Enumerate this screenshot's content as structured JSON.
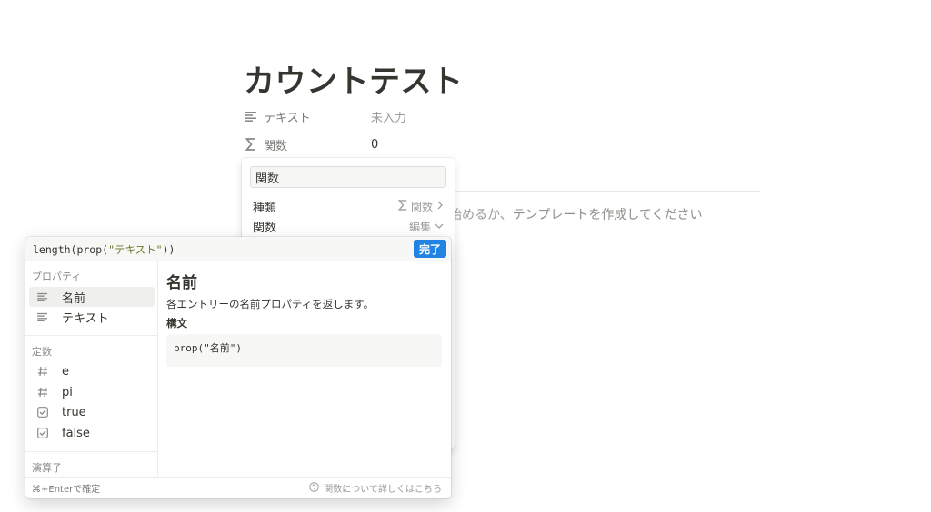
{
  "page": {
    "title": "カウントテスト",
    "properties": [
      {
        "icon": "text-lines-icon",
        "name": "テキスト",
        "value": "未入力"
      },
      {
        "icon": "sigma-icon",
        "name": "関数",
        "value": "0"
      }
    ],
    "empty_hint_prefix": "始めるか、",
    "empty_hint_link": "テンプレートを作成してください"
  },
  "property_popup": {
    "name_value": "関数",
    "type_label": "種類",
    "type_value": "関数",
    "formula_label": "関数",
    "formula_action": "編集"
  },
  "formula_editor": {
    "expression_prefix": "length(prop(",
    "expression_string": "\"テキスト\"",
    "expression_suffix": "))",
    "done_label": "完了",
    "sections": {
      "properties_label": "プロパティ",
      "properties": [
        {
          "icon": "text-lines-icon",
          "label": "名前",
          "selected": true
        },
        {
          "icon": "text-lines-icon",
          "label": "テキスト",
          "selected": false
        }
      ],
      "constants_label": "定数",
      "constants": [
        {
          "icon": "hash-icon",
          "label": "e"
        },
        {
          "icon": "hash-icon",
          "label": "pi"
        },
        {
          "icon": "checkbox-icon",
          "label": "true"
        },
        {
          "icon": "checkbox-icon",
          "label": "false"
        }
      ],
      "operators_label": "演算子"
    },
    "help": {
      "title": "名前",
      "description": "各エントリーの名前プロパティを返します。",
      "syntax_label": "構文",
      "syntax_code": "prop(\"名前\")"
    },
    "footer": {
      "shortcut": "⌘+Enterで確定",
      "learn_more": "関数について詳しくはこちら"
    }
  }
}
